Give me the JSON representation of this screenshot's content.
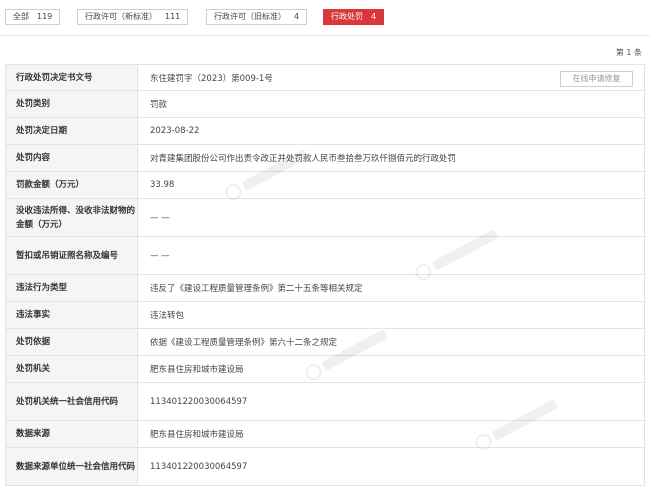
{
  "tabs": [
    {
      "label": "全部",
      "count": "119",
      "active": false
    },
    {
      "label": "行政许可（新标准）",
      "count": "111",
      "active": false
    },
    {
      "label": "行政许可（旧标准）",
      "count": "4",
      "active": false
    },
    {
      "label": "行政处罚",
      "count": "4",
      "active": true
    }
  ],
  "page_count": "第 1 条",
  "repair_button": "在线申请修复",
  "rows": [
    {
      "label": "行政处罚决定书文号",
      "value": "东住建罚字（2023）第009-1号"
    },
    {
      "label": "处罚类别",
      "value": "罚款"
    },
    {
      "label": "处罚决定日期",
      "value": "2023-08-22"
    },
    {
      "label": "处罚内容",
      "value": "对青建集团股份公司作出责令改正并处罚款人民币叁拾叁万玖仟捌佰元的行政处罚"
    },
    {
      "label": "罚款金额（万元）",
      "value": "33.98"
    },
    {
      "label": "没收违法所得、没收非法财物的金额（万元）",
      "value": "— —"
    },
    {
      "label": "暂扣或吊销证照名称及编号",
      "value": "— —"
    },
    {
      "label": "违法行为类型",
      "value": "违反了《建设工程质量管理条例》第二十五条等相关规定"
    },
    {
      "label": "违法事实",
      "value": "违法转包"
    },
    {
      "label": "处罚依据",
      "value": "依据《建设工程质量管理条例》第六十二条之规定"
    },
    {
      "label": "处罚机关",
      "value": "肥东县住房和城市建设局"
    },
    {
      "label": "处罚机关统一社会信用代码",
      "value": "113401220030064597"
    },
    {
      "label": "数据来源",
      "value": "肥东县住房和城市建设局"
    },
    {
      "label": "数据来源单位统一社会信用代码",
      "value": "113401220030064597"
    }
  ],
  "colors": {
    "accent": "#d9373a",
    "label_bg": "#f5f5f5",
    "border": "#e3e3e3"
  }
}
